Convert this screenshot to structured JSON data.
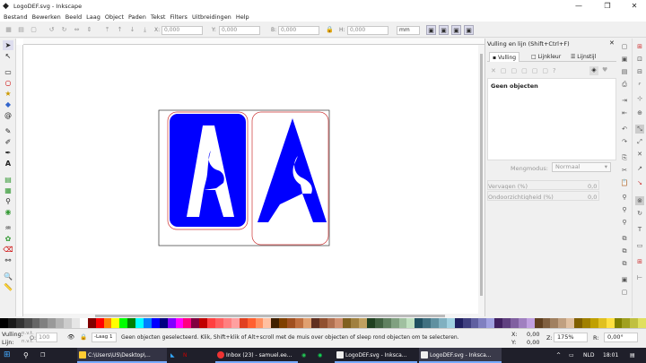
{
  "window": {
    "title": "LogoDEF.svg - Inkscape",
    "controls": [
      "—",
      "❐",
      "✕"
    ]
  },
  "menu": [
    "Bestand",
    "Bewerken",
    "Beeld",
    "Laag",
    "Object",
    "Paden",
    "Tekst",
    "Filters",
    "Uitbreidingen",
    "Help"
  ],
  "toolbar": {
    "x_label": "X:",
    "x_value": "0,000",
    "y_label": "Y:",
    "y_value": "0,000",
    "b_label": "B:",
    "b_value": "0,000",
    "h_label": "H:",
    "h_value": "0,000",
    "unit": "mm"
  },
  "panel": {
    "title": "Vulling en lijn (Shift+Ctrl+F)",
    "tabs": [
      "Vulling",
      "Lijnkleur",
      "Lijnstijl"
    ],
    "empty_text": "Geen objecten",
    "blend_label": "Mengmodus:",
    "blend_value": "Normaal",
    "blur_label": "Vervagen (%)",
    "blur_value": "0,0",
    "opacity_label": "Ondoorzichtigheid (%)",
    "opacity_value": "0,0"
  },
  "status": {
    "fill_label": "Vulling:",
    "stroke_label": "Lijn:",
    "fill_value": "n.v.t.",
    "stroke_value": "n.v.t.",
    "o_label": "O:",
    "o_value": "100",
    "layer": "-Laag 1",
    "message": "Geen objecten geselecteerd. Klik, Shift+klik of Alt+scroll met de muis over objecten of sleep rond objecten om te selecteren.",
    "x_label": "X:",
    "x_value": "0,00",
    "y_label": "Y:",
    "y_value": "0,00",
    "z_label": "Z:",
    "zoom": "175%",
    "r_label": "R:",
    "rotation": "0,00°"
  },
  "taskbar": {
    "items": [
      "C:\\Users\\US\\Desktop\\...",
      "Inbox (23) - samuel.ee...",
      "LogoDEF.svg - Inksca...",
      "LogoDEF.svg - Inksca..."
    ],
    "lang": "NLD",
    "time": "18:01"
  },
  "colors": {
    "logo_blue": "#0000ff",
    "accent": "#1e1e2a"
  },
  "palette": [
    "#000000",
    "#1a1a1a",
    "#333333",
    "#4d4d4d",
    "#666666",
    "#808080",
    "#999999",
    "#b3b3b3",
    "#cccccc",
    "#e6e6e6",
    "#ffffff",
    "#800000",
    "#ff0000",
    "#ff8000",
    "#ffff00",
    "#00ff00",
    "#008000",
    "#00ffff",
    "#0080ff",
    "#0000ff",
    "#000080",
    "#8000ff",
    "#ff00ff",
    "#ff0080",
    "#800040",
    "#c00000",
    "#ff4040",
    "#ff6060",
    "#ff8080",
    "#ffa0a0",
    "#e04020",
    "#ff6030",
    "#ff9060",
    "#ffc0a0",
    "#402000",
    "#804000",
    "#a05020",
    "#c07040",
    "#e0a070",
    "#603020",
    "#905030",
    "#b07050",
    "#d09070",
    "#806020",
    "#a08040",
    "#c0a060",
    "#204020",
    "#406040",
    "#608060",
    "#80a080",
    "#a0c0a0",
    "#c0e0c0",
    "#205060",
    "#407080",
    "#6090a0",
    "#80b0c0",
    "#a0d0e0",
    "#202060",
    "#404080",
    "#6060a0",
    "#8080c0",
    "#a0a0e0",
    "#402060",
    "#604080",
    "#8060a0",
    "#a080c0",
    "#c0a0e0",
    "#604020",
    "#806040",
    "#a08060",
    "#c0a080",
    "#e0c0a0",
    "#806000",
    "#a08000",
    "#c0a000",
    "#e0c020",
    "#ffe040",
    "#808000",
    "#a0a020",
    "#c0c040",
    "#e0e060"
  ]
}
